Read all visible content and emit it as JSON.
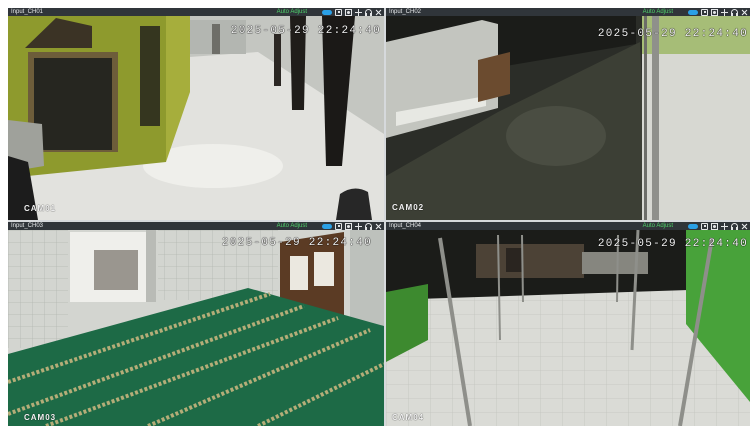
{
  "colors": {
    "page_background": "#ffffff",
    "divider": "#d6d9dc",
    "bar_background": "#30353a",
    "status_text": "#4fd36b",
    "toggle": "#2aa0e6",
    "overlay_text": "#f4f4f4"
  },
  "toolbar": {
    "icons": [
      "toggle-icon",
      "snapshot-icon",
      "record-icon",
      "ptz-icon",
      "audio-icon",
      "close-icon"
    ]
  },
  "panels": [
    {
      "channel": "Input_CH01",
      "status": "Auto Adjust",
      "timestamp": "2025-05-29 22:24:40",
      "camera_label": "CAM01"
    },
    {
      "channel": "Input_CH02",
      "status": "Auto Adjust",
      "timestamp": "2025-05-29 22:24:40",
      "camera_label": "CAM02"
    },
    {
      "channel": "Input_CH03",
      "status": "Auto Adjust",
      "timestamp": "2025-05-29 22:24:40",
      "camera_label": "CAM03"
    },
    {
      "channel": "Input_CH04",
      "status": "Auto Adjust",
      "timestamp": "2025-05-29 22:24:40",
      "camera_label": "CAM04"
    }
  ]
}
